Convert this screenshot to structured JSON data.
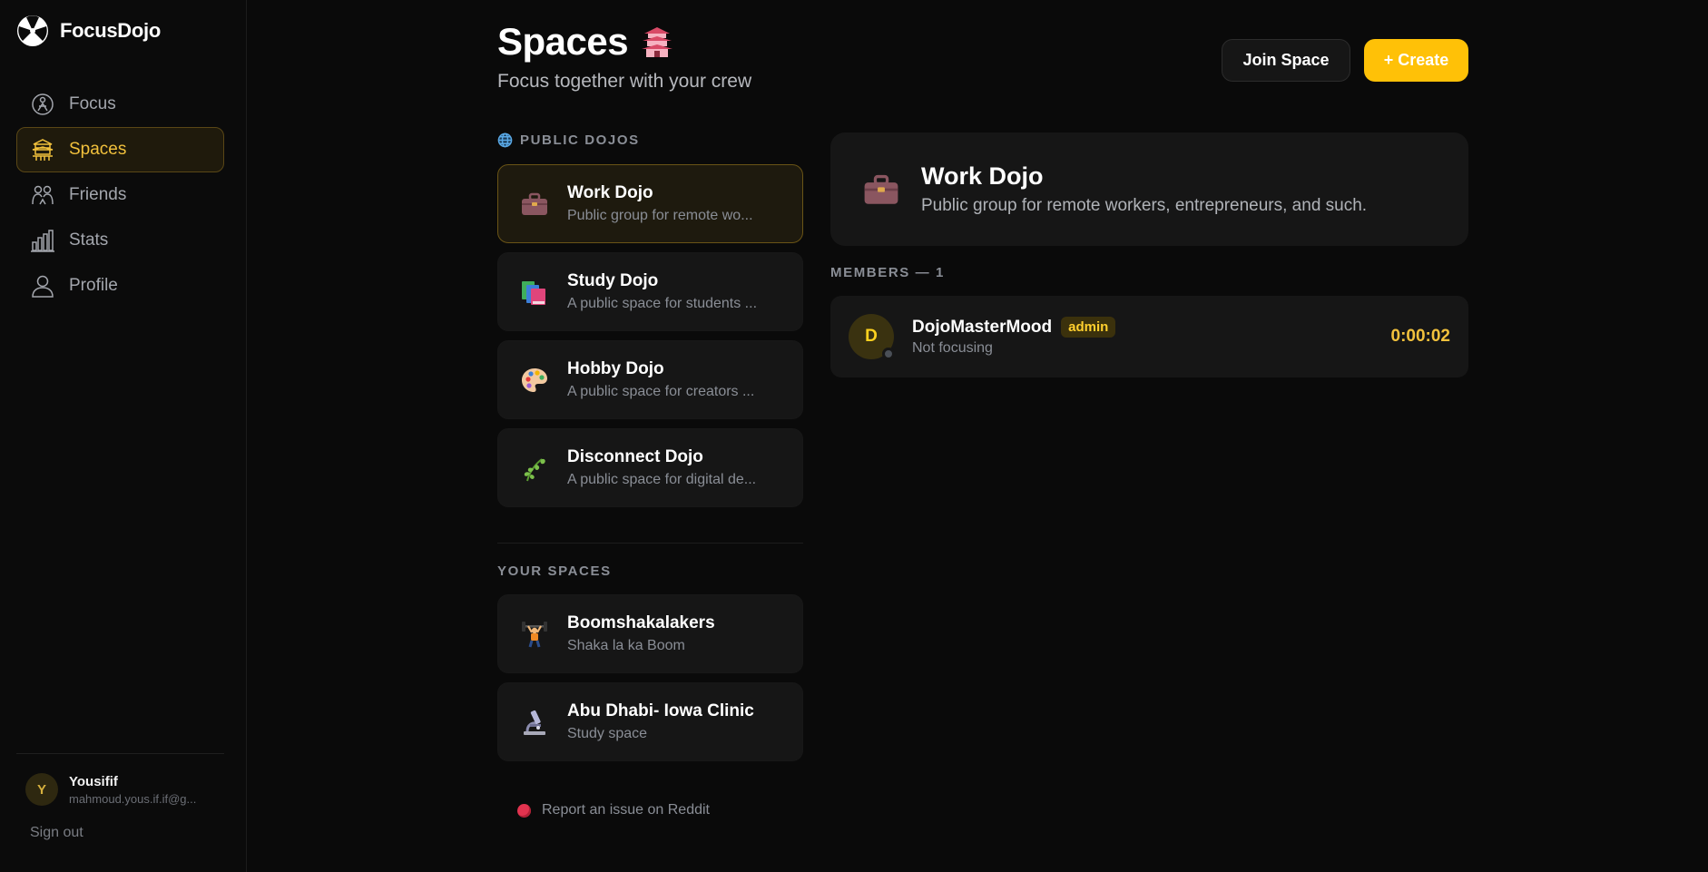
{
  "app": {
    "name": "FocusDojo"
  },
  "sidebar": {
    "items": [
      {
        "label": "Focus",
        "icon": "focus-icon"
      },
      {
        "label": "Spaces",
        "icon": "pagoda-icon",
        "active": true
      },
      {
        "label": "Friends",
        "icon": "friends-icon"
      },
      {
        "label": "Stats",
        "icon": "stats-icon"
      },
      {
        "label": "Profile",
        "icon": "profile-icon"
      }
    ],
    "user": {
      "initial": "Y",
      "name": "Yousifif",
      "email": "mahmoud.yous.if.if@g..."
    },
    "sign_out": "Sign out"
  },
  "header": {
    "title": "Spaces",
    "title_emoji": "pagoda-icon",
    "subtitle": "Focus together with your crew",
    "join_label": "Join Space",
    "create_label": "+ Create"
  },
  "public_dojos": {
    "label": "PUBLIC DOJOS",
    "items": [
      {
        "title": "Work Dojo",
        "desc": "Public group for remote wo...",
        "icon": "briefcase-icon",
        "selected": true
      },
      {
        "title": "Study Dojo",
        "desc": "A public space for students ...",
        "icon": "books-icon"
      },
      {
        "title": "Hobby Dojo",
        "desc": "A public space for creators ...",
        "icon": "palette-icon"
      },
      {
        "title": "Disconnect Dojo",
        "desc": "A public space for digital de...",
        "icon": "herb-icon"
      }
    ]
  },
  "your_spaces": {
    "label": "YOUR SPACES",
    "items": [
      {
        "title": "Boomshakalakers",
        "desc": "Shaka la ka Boom",
        "icon": "weightlifter-icon"
      },
      {
        "title": "Abu Dhabi- Iowa Clinic",
        "desc": "Study space",
        "icon": "microscope-icon"
      }
    ]
  },
  "report": {
    "label": "Report an issue on Reddit"
  },
  "detail": {
    "title": "Work Dojo",
    "desc": "Public group for remote workers, entrepreneurs, and such.",
    "members_label": "MEMBERS — 1",
    "members": [
      {
        "initial": "D",
        "name": "DojoMasterMood",
        "badge": "admin",
        "status": "Not focusing",
        "timer": "0:00:02"
      }
    ]
  },
  "colors": {
    "accent": "#ffc107",
    "accent_text": "#f2c13c",
    "background": "#0a0a0a",
    "card": "#161616"
  }
}
